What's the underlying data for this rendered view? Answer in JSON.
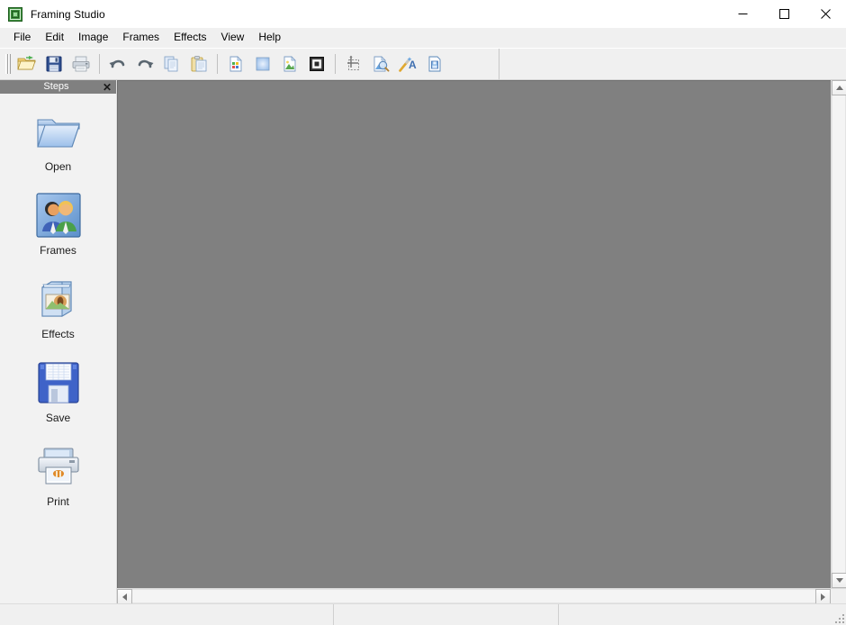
{
  "window": {
    "title": "Framing Studio",
    "app_icon": "frame-square-icon",
    "controls": {
      "minimize": "minimize-button",
      "maximize": "maximize-button",
      "close": "close-button"
    }
  },
  "menubar": {
    "items": [
      {
        "label": "File"
      },
      {
        "label": "Edit"
      },
      {
        "label": "Image"
      },
      {
        "label": "Frames"
      },
      {
        "label": "Effects"
      },
      {
        "label": "View"
      },
      {
        "label": "Help"
      }
    ]
  },
  "toolbar": {
    "groups": [
      {
        "buttons": [
          {
            "name": "open-file",
            "icon": "open-folder-icon",
            "tooltip": "Open"
          },
          {
            "name": "save-file",
            "icon": "floppy-save-icon",
            "tooltip": "Save"
          },
          {
            "name": "print",
            "icon": "printer-icon",
            "tooltip": "Print"
          }
        ]
      },
      {
        "buttons": [
          {
            "name": "undo",
            "icon": "undo-arrow-icon",
            "tooltip": "Undo"
          },
          {
            "name": "redo",
            "icon": "redo-arrow-icon",
            "tooltip": "Redo"
          },
          {
            "name": "copy",
            "icon": "copy-pages-icon",
            "tooltip": "Copy"
          },
          {
            "name": "paste",
            "icon": "paste-clipboard-icon",
            "tooltip": "Paste"
          }
        ]
      },
      {
        "buttons": [
          {
            "name": "new-image",
            "icon": "new-image-icon",
            "tooltip": "New Image"
          },
          {
            "name": "background-color",
            "icon": "blue-gradient-square-icon",
            "tooltip": "Background"
          },
          {
            "name": "picture",
            "icon": "landscape-picture-icon",
            "tooltip": "Picture"
          },
          {
            "name": "frame-border",
            "icon": "frame-border-icon",
            "tooltip": "Frame"
          }
        ]
      },
      {
        "buttons": [
          {
            "name": "crop",
            "icon": "crop-dashed-icon",
            "tooltip": "Crop"
          },
          {
            "name": "effects",
            "icon": "effects-magic-icon",
            "tooltip": "Effects"
          },
          {
            "name": "text-tool",
            "icon": "text-wand-icon",
            "tooltip": "Add Text"
          },
          {
            "name": "save-as",
            "icon": "save-as-document-icon",
            "tooltip": "Save As"
          }
        ]
      }
    ]
  },
  "sidebar": {
    "title": "Steps",
    "close_label": "✕",
    "steps": [
      {
        "label": "Open",
        "icon": "open-folder-icon"
      },
      {
        "label": "Frames",
        "icon": "people-frames-icon"
      },
      {
        "label": "Effects",
        "icon": "effects-box-icon"
      },
      {
        "label": "Save",
        "icon": "floppy-disk-icon"
      },
      {
        "label": "Print",
        "icon": "printer-icon"
      }
    ]
  },
  "canvas": {
    "background_color": "#808080",
    "vertical_scrollbar": {
      "up_button": "scroll-up-button",
      "down_button": "scroll-down-button"
    },
    "horizontal_scrollbar": {
      "left_button": "scroll-left-button",
      "right_button": "scroll-right-button"
    }
  },
  "statusbar": {
    "cells": [
      {
        "text": ""
      },
      {
        "text": ""
      },
      {
        "text": ""
      }
    ]
  },
  "colors": {
    "window_bg": "#f0f0f0",
    "titlebar_bg": "#ffffff",
    "canvas_gray": "#808080",
    "panel_header": "#808080",
    "sidebar_bg": "#f2f2f2",
    "accent_blue": "#3a6ea5"
  }
}
